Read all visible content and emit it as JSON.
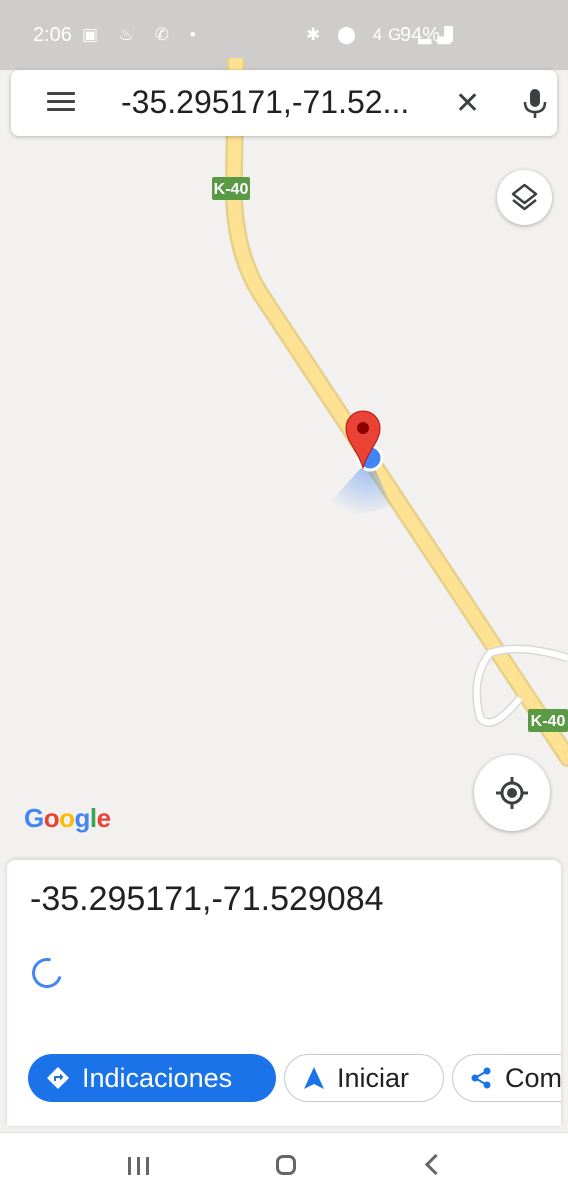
{
  "status_bar": {
    "time": "2:06",
    "left_icons": [
      "gallery-icon",
      "notification-icon",
      "whatsapp-icon",
      "dot-icon"
    ],
    "left_icon_glyphs": "▣ ♨ ✆ •",
    "right_icons": [
      "bluetooth-icon",
      "location-icon",
      "4g-icon",
      "signal-icon"
    ],
    "right_icon_glyphs": "✱ ⬤ 4G ▂▃",
    "battery": "94%"
  },
  "search": {
    "query": "-35.295171,-71.52..."
  },
  "map": {
    "road_labels": [
      "K-40",
      "K-40"
    ]
  },
  "logo": {
    "letters": [
      "G",
      "o",
      "o",
      "g",
      "l",
      "e"
    ],
    "colors": [
      "#4285f4",
      "#ea4335",
      "#fbbc05",
      "#4285f4",
      "#34a853",
      "#ea4335"
    ]
  },
  "place": {
    "title": "-35.295171,-71.529084"
  },
  "actions": {
    "directions_label": "Indicaciones",
    "start_label": "Iniciar",
    "share_label": "Com"
  },
  "colors": {
    "accent": "#1a73e8",
    "pin": "#ea4335",
    "road": "#fde293",
    "road_label_bg": "#5b9a45"
  }
}
